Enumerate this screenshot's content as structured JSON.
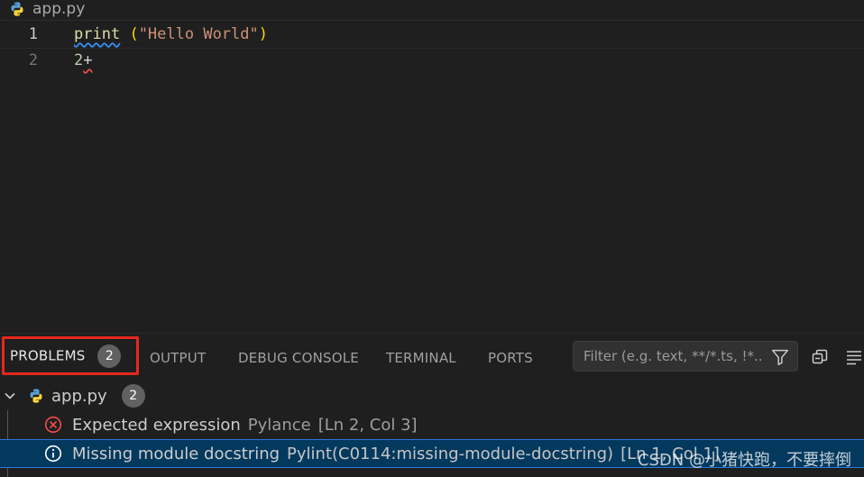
{
  "breadcrumb": {
    "file": "app.py"
  },
  "editor": {
    "lines": [
      {
        "number": "1",
        "tokens": {
          "keyword": "print",
          "space": " ",
          "open": "(",
          "string": "\"Hello World\"",
          "close": ")"
        }
      },
      {
        "number": "2",
        "tokens": {
          "number": "2",
          "operator": "+"
        }
      }
    ]
  },
  "panel": {
    "tabs": [
      {
        "label": "PROBLEMS",
        "badge": "2"
      },
      {
        "label": "OUTPUT"
      },
      {
        "label": "DEBUG CONSOLE"
      },
      {
        "label": "TERMINAL"
      },
      {
        "label": "PORTS"
      }
    ],
    "filter": {
      "placeholder": "Filter (e.g. text, **/*.ts, !*..."
    }
  },
  "problems": {
    "file": {
      "name": "app.py",
      "count": "2"
    },
    "items": [
      {
        "message": "Expected expression",
        "source": "Pylance",
        "location": "[Ln 2, Col 3]",
        "severity": "error"
      },
      {
        "message": "Missing module docstring",
        "source": "Pylint(C0114:missing-module-docstring)",
        "location": "[Ln 1, Col 1]",
        "severity": "info"
      }
    ]
  },
  "watermark": "CSDN @小猪快跑，不要摔倒",
  "colors": {
    "error": "#f14c4c",
    "info": "#3794ff",
    "selection": "#04395e",
    "highlight": "#e5281f"
  },
  "icons": [
    "python-file-icon",
    "filter-icon",
    "collapse-all-icon",
    "view-as-list-icon",
    "error-icon",
    "info-icon",
    "chevron-down-icon"
  ]
}
